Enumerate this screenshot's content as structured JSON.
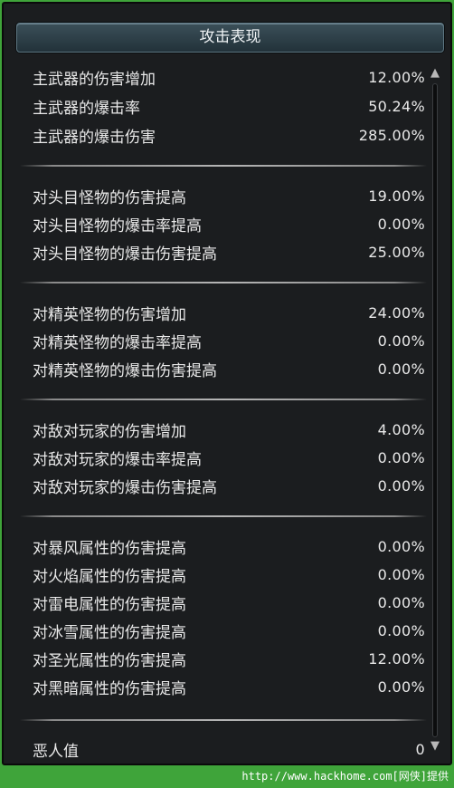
{
  "panel": {
    "title": "攻击表现"
  },
  "sections": [
    {
      "rows": [
        {
          "label": "主武器的伤害增加",
          "value": "12.00%"
        },
        {
          "label": "主武器的爆击率",
          "value": "50.24%"
        },
        {
          "label": "主武器的爆击伤害",
          "value": "285.00%"
        }
      ]
    },
    {
      "rows": [
        {
          "label": "对头目怪物的伤害提高",
          "value": "19.00%"
        },
        {
          "label": "对头目怪物的爆击率提高",
          "value": "0.00%"
        },
        {
          "label": "对头目怪物的爆击伤害提高",
          "value": "25.00%"
        }
      ]
    },
    {
      "rows": [
        {
          "label": "对精英怪物的伤害增加",
          "value": "24.00%"
        },
        {
          "label": "对精英怪物的爆击率提高",
          "value": "0.00%"
        },
        {
          "label": "对精英怪物的爆击伤害提高",
          "value": "0.00%"
        }
      ]
    },
    {
      "rows": [
        {
          "label": "对敌对玩家的伤害增加",
          "value": "4.00%"
        },
        {
          "label": "对敌对玩家的爆击率提高",
          "value": "0.00%"
        },
        {
          "label": "对敌对玩家的爆击伤害提高",
          "value": "0.00%"
        }
      ]
    },
    {
      "rows": [
        {
          "label": "对暴风属性的伤害提高",
          "value": "0.00%"
        },
        {
          "label": "对火焰属性的伤害提高",
          "value": "0.00%"
        },
        {
          "label": "对雷电属性的伤害提高",
          "value": "0.00%"
        },
        {
          "label": "对冰雪属性的伤害提高",
          "value": "0.00%"
        },
        {
          "label": "对圣光属性的伤害提高",
          "value": "12.00%"
        },
        {
          "label": "对黑暗属性的伤害提高",
          "value": "0.00%"
        }
      ]
    },
    {
      "rows": [
        {
          "label": "恶人值",
          "value": "0"
        }
      ]
    }
  ],
  "icons": {
    "scroll_up": "chevron-up-icon",
    "scroll_down": "chevron-down-icon"
  },
  "watermark": "http://www.hackhome.com[网侠]提供"
}
